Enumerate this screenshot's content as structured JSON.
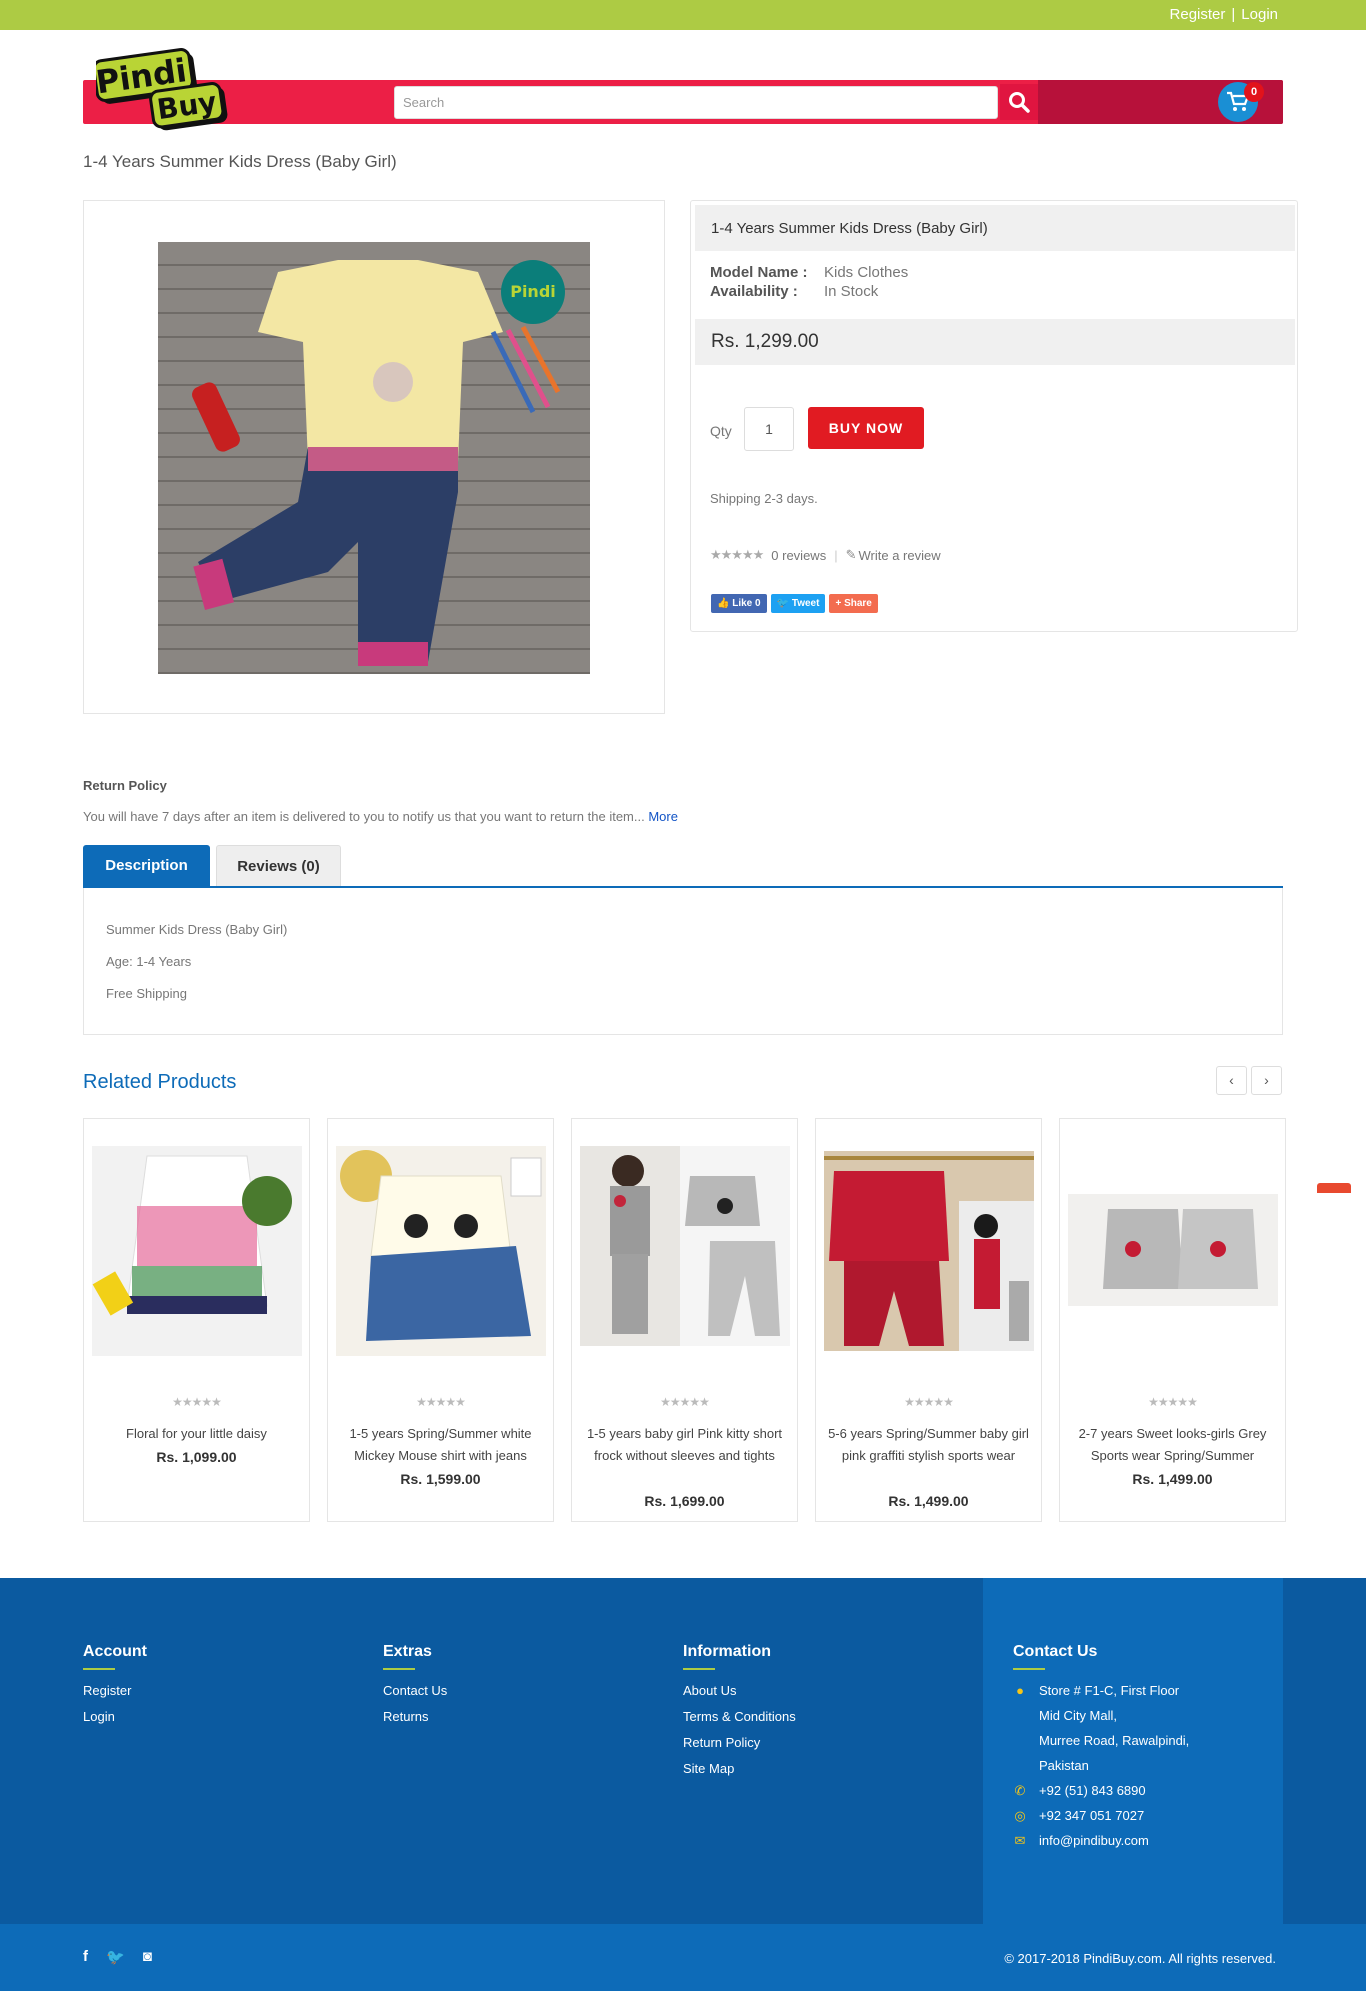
{
  "topbar": {
    "register": "Register",
    "separator": "|",
    "login": "Login"
  },
  "header": {
    "logo_text_1": "Pindi",
    "logo_text_2": "Buy",
    "search_placeholder": "Search",
    "cart_count": "0"
  },
  "page_title": "1-4 Years Summer Kids Dress (Baby Girl)",
  "product": {
    "name": "1-4 Years Summer Kids Dress (Baby Girl)",
    "model_label": "Model Name :",
    "model_value": "Kids Clothes",
    "availability_label": "Availability :",
    "availability_value": "In Stock",
    "price": "Rs. 1,299.00",
    "qty_label": "Qty",
    "qty_value": "1",
    "buy_label": "BUY NOW",
    "shipping": "Shipping 2-3 days.",
    "reviews": "0 reviews",
    "write_review": "Write a review",
    "social": {
      "like": "Like 0",
      "tweet": "Tweet",
      "share": "Share"
    }
  },
  "return_policy": {
    "title": "Return Policy",
    "text": "You will have 7 days after an item is delivered to you to notify us that you want to return the item...",
    "more": "More"
  },
  "tabs": {
    "description": "Description",
    "reviews": "Reviews (0)"
  },
  "description_lines": [
    "Summer Kids Dress (Baby Girl)",
    "Age: 1-4 Years",
    "Free Shipping"
  ],
  "related": {
    "title": "Related Products",
    "items": [
      {
        "name": "Floral for your little daisy",
        "price": "Rs. 1,099.00"
      },
      {
        "name": "1-5 years Spring/Summer white Mickey Mouse shirt with jeans",
        "price": "Rs. 1,599.00"
      },
      {
        "name": "1-5 years baby girl Pink kitty short frock without sleeves and tights",
        "price": "Rs. 1,699.00"
      },
      {
        "name": "5-6 years Spring/Summer baby girl pink graffiti stylish sports wear",
        "price": "Rs. 1,499.00"
      },
      {
        "name": "2-7 years Sweet looks-girls Grey Sports wear Spring/Summer",
        "price": "Rs. 1,499.00"
      }
    ]
  },
  "footer": {
    "account": {
      "title": "Account",
      "links": [
        "Register",
        "Login"
      ]
    },
    "extras": {
      "title": "Extras",
      "links": [
        "Contact Us",
        "Returns"
      ]
    },
    "information": {
      "title": "Information",
      "links": [
        "About Us",
        "Terms & Conditions",
        "Return Policy",
        "Site Map"
      ]
    },
    "contact": {
      "title": "Contact Us",
      "address": [
        "Store # F1-C, First Floor",
        "Mid City Mall,",
        "Murree Road, Rawalpindi,",
        "Pakistan"
      ],
      "phone": "+92 (51) 843 6890",
      "whatsapp": "+92 347 051 7027",
      "email": "info@pindibuy.com"
    },
    "copyright": "© 2017-2018 PindiBuy.com. All rights reserved."
  },
  "colors": {
    "green": "#adcb44",
    "red": "#ec1f46",
    "blue": "#0d6bb8",
    "buy": "#e11b22"
  }
}
